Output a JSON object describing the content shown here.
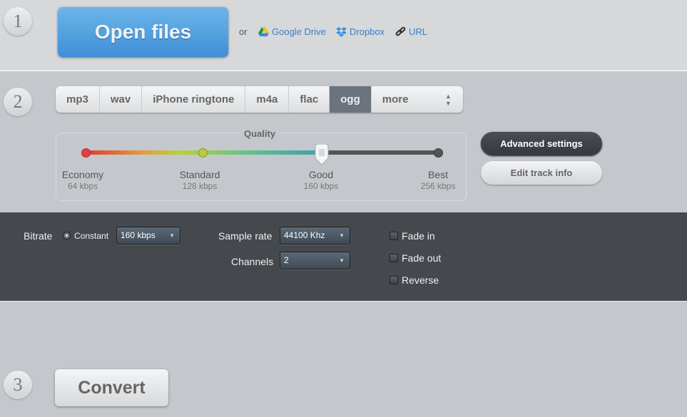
{
  "steps": [
    "1",
    "2",
    "3"
  ],
  "open": {
    "label": "Open files",
    "or": "or",
    "links": [
      {
        "label": "Google Drive",
        "icon": "google-drive-icon"
      },
      {
        "label": "Dropbox",
        "icon": "dropbox-icon"
      },
      {
        "label": "URL",
        "icon": "link-icon"
      }
    ]
  },
  "formats": {
    "tabs": [
      "mp3",
      "wav",
      "iPhone ringtone",
      "m4a",
      "flac",
      "ogg"
    ],
    "selected": "ogg",
    "more": "more"
  },
  "quality": {
    "title": "Quality",
    "value_kbps": 160,
    "marks": [
      {
        "label": "Economy",
        "kbps": "64 kbps"
      },
      {
        "label": "Standard",
        "kbps": "128 kbps"
      },
      {
        "label": "Good",
        "kbps": "160 kbps"
      },
      {
        "label": "Best",
        "kbps": "256 kbps"
      }
    ]
  },
  "buttons": {
    "advanced": "Advanced settings",
    "edit": "Edit track info",
    "convert": "Convert"
  },
  "advanced": {
    "bitrate_label": "Bitrate",
    "bitrate_mode": "Constant",
    "bitrate_value": "160 kbps",
    "sample_rate_label": "Sample rate",
    "sample_rate_value": "44100 Khz",
    "channels_label": "Channels",
    "channels_value": "2",
    "checkboxes": [
      {
        "label": "Fade in",
        "checked": false
      },
      {
        "label": "Fade out",
        "checked": false
      },
      {
        "label": "Reverse",
        "checked": false
      }
    ]
  }
}
